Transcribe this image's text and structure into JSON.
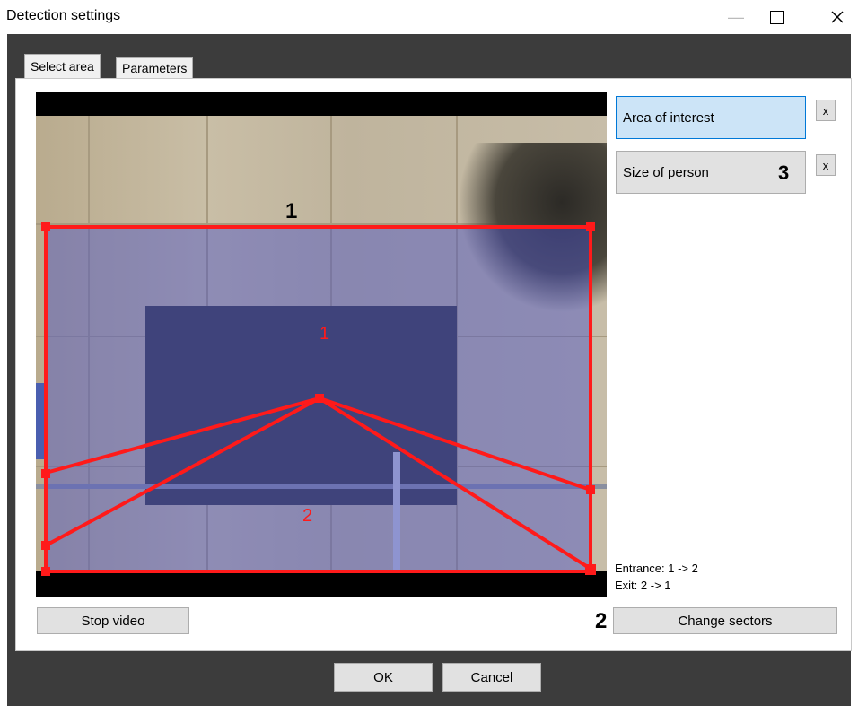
{
  "window": {
    "title": "Detection settings"
  },
  "tabs": [
    {
      "label": "Select area"
    },
    {
      "label": "Parameters"
    }
  ],
  "areas": {
    "area_of_interest": "Area of interest",
    "size_of_person": "Size of person",
    "remove_label": "x"
  },
  "sectors": {
    "sector1": "1",
    "sector2": "2"
  },
  "info": {
    "entrance": "Entrance: 1 -> 2",
    "exit": "Exit: 2 -> 1"
  },
  "buttons": {
    "stop_video": "Stop video",
    "change_sectors": "Change sectors",
    "ok": "OK",
    "cancel": "Cancel"
  },
  "callouts": {
    "c1": "1",
    "c2": "2",
    "c3": "3"
  },
  "colors": {
    "zone_outline": "#ff1a1a",
    "overlay": "#4650c8",
    "selected_button": "#cce4f7",
    "dialog_border": "#3c3c3c"
  }
}
